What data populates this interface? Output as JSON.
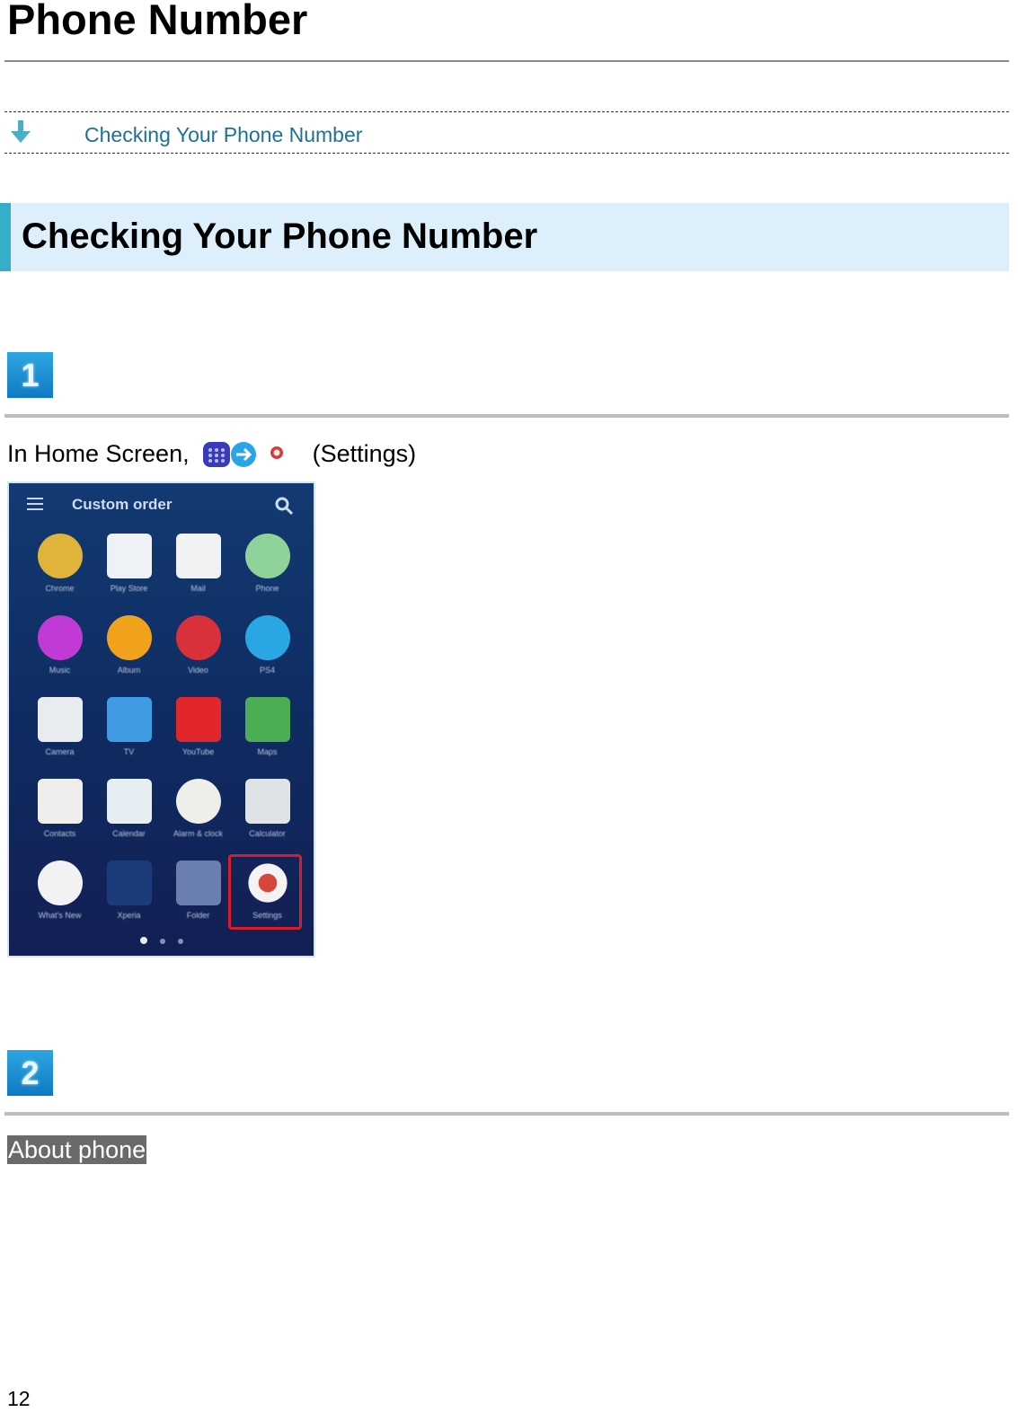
{
  "page": {
    "title": "Phone Number",
    "page_number": "12"
  },
  "toc": {
    "arrow_icon": "down-arrow-icon",
    "link_label": "Checking Your Phone Number"
  },
  "section": {
    "title": "Checking Your Phone Number"
  },
  "steps": [
    {
      "number": "1",
      "instruction_prefix": "In Home Screen,",
      "instruction_icons": [
        "apps-grid-icon",
        "arrow-right-icon",
        "settings-icon"
      ],
      "instruction_suffix": "(Settings)",
      "screenshot": {
        "header_title": "Custom order",
        "apps": [
          {
            "label": "Chrome",
            "icon": "chrome-icon",
            "color": "#e0b43a"
          },
          {
            "label": "Play Store",
            "icon": "play-store-icon",
            "color": "#eef1f5"
          },
          {
            "label": "Mail",
            "icon": "mail-icon",
            "color": "#f1f2f4"
          },
          {
            "label": "Phone",
            "icon": "phone-icon",
            "color": "#8fd39a"
          },
          {
            "label": "Music",
            "icon": "music-icon",
            "color": "#c13ad6"
          },
          {
            "label": "Album",
            "icon": "album-icon",
            "color": "#f0a21c"
          },
          {
            "label": "Video",
            "icon": "video-icon",
            "color": "#d9313a"
          },
          {
            "label": "PS4",
            "icon": "ps4-icon",
            "color": "#2aa6e4"
          },
          {
            "label": "Camera",
            "icon": "camera-icon",
            "color": "#e8ecf0"
          },
          {
            "label": "TV",
            "icon": "tv-icon",
            "color": "#3f9be4"
          },
          {
            "label": "YouTube",
            "icon": "youtube-icon",
            "color": "#e3262b"
          },
          {
            "label": "Maps",
            "icon": "maps-icon",
            "color": "#4cae54"
          },
          {
            "label": "Contacts",
            "icon": "contacts-icon",
            "color": "#f0eeec"
          },
          {
            "label": "Calendar",
            "icon": "calendar-icon",
            "color": "#e6edf3"
          },
          {
            "label": "Alarm & clock",
            "icon": "alarm-clock-icon",
            "color": "#eeeeea"
          },
          {
            "label": "Calculator",
            "icon": "calculator-icon",
            "color": "#dfe3e6"
          },
          {
            "label": "What's New",
            "icon": "whats-new-icon",
            "color": "#f2f2f2"
          },
          {
            "label": "Xperia",
            "icon": "xperia-lounge-icon",
            "color": "#1c3b7a"
          },
          {
            "label": "Folder",
            "icon": "folder-icon",
            "color": "#6a7fb0"
          },
          {
            "label": "Settings",
            "icon": "settings-icon",
            "color": "#f4f2f2",
            "highlighted": true
          }
        ]
      }
    },
    {
      "number": "2",
      "highlighted_text": "About phone"
    }
  ]
}
